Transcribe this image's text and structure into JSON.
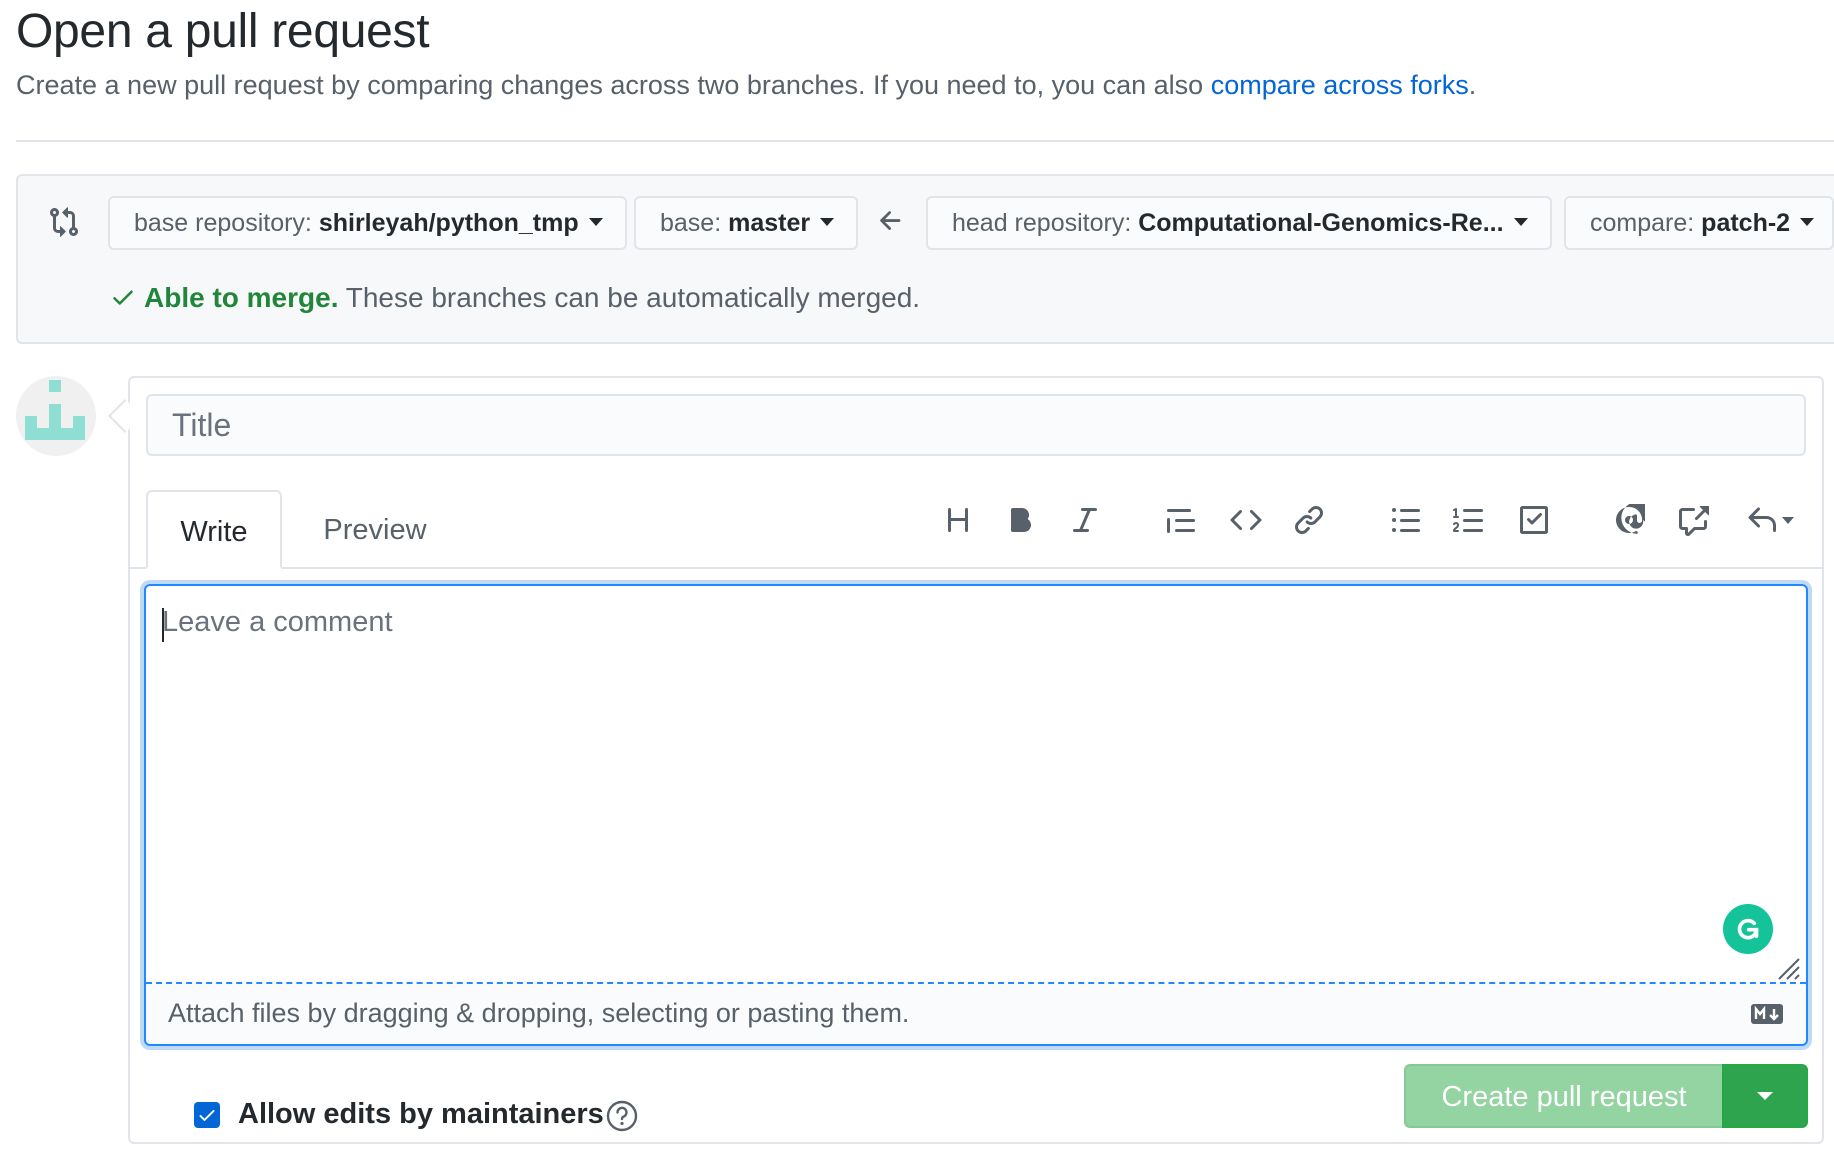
{
  "header": {
    "title": "Open a pull request",
    "description": "Create a new pull request by comparing changes across two branches. If you need to, you can also ",
    "link_text": "compare across forks",
    "description_end": "."
  },
  "compare": {
    "base_repo_label": "base repository: ",
    "base_repo_value": "shirleyah/python_tmp",
    "base_label": "base: ",
    "base_value": "master",
    "head_repo_label": "head repository: ",
    "head_repo_value": "Computational-Genomics-Re...",
    "compare_label": "compare: ",
    "compare_value": "patch-2",
    "merge_ok": "Able to merge.",
    "merge_text": " These branches can be automatically merged."
  },
  "form": {
    "title_placeholder": "Title",
    "tabs": [
      {
        "label": "Write"
      },
      {
        "label": "Preview"
      }
    ],
    "comment_placeholder": "Leave a comment",
    "attach_text": "Attach files by dragging & dropping, selecting or pasting them.",
    "allow_edits_label": "Allow edits by maintainers",
    "allow_edits_checked": true,
    "create_button": "Create pull request"
  },
  "toolbar_icons": [
    "heading-icon",
    "bold-icon",
    "italic-icon",
    "quote-icon",
    "code-icon",
    "link-icon",
    "bulleted-list-icon",
    "numbered-list-icon",
    "task-list-icon",
    "mention-icon",
    "cross-reference-icon",
    "reply-icon"
  ],
  "colors": {
    "link": "#0366d6",
    "success": "#22863a",
    "primary_button": "#2ea44f",
    "primary_button_disabled": "#94d3a2",
    "focus_border": "#2188ff"
  }
}
